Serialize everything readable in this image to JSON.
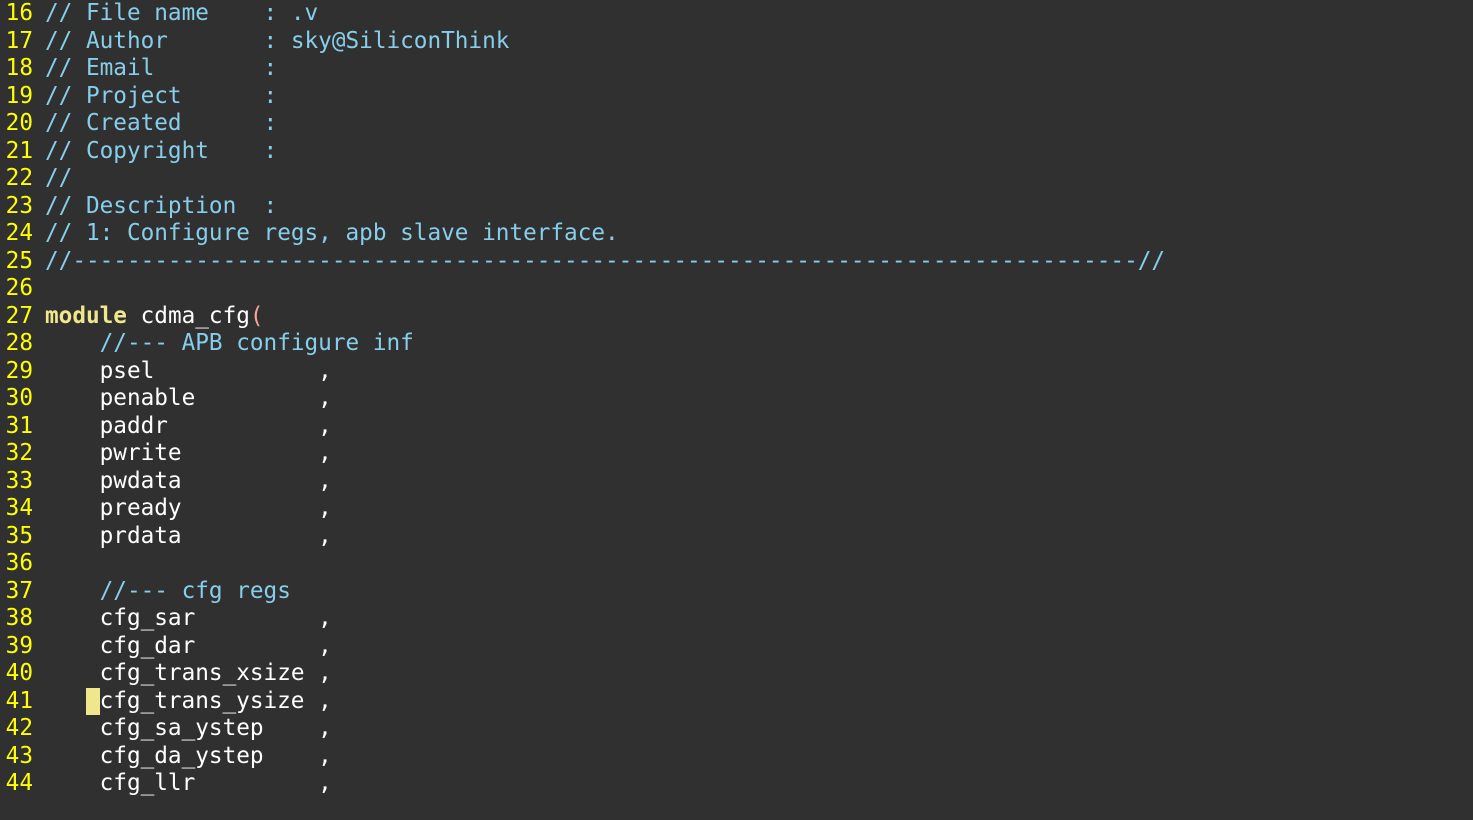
{
  "editor": {
    "lines": [
      {
        "num": "16",
        "text": "// File name    : .v"
      },
      {
        "num": "17",
        "text": "// Author       : sky@SiliconThink"
      },
      {
        "num": "18",
        "text": "// Email        :"
      },
      {
        "num": "19",
        "text": "// Project      :"
      },
      {
        "num": "20",
        "text": "// Created      :"
      },
      {
        "num": "21",
        "text": "// Copyright    :"
      },
      {
        "num": "22",
        "text": "//"
      },
      {
        "num": "23",
        "text": "// Description  :"
      },
      {
        "num": "24",
        "text": "// 1: Configure regs, apb slave interface."
      },
      {
        "num": "25",
        "text": "//------------------------------------------------------------------------------//"
      },
      {
        "num": "26",
        "text": ""
      },
      {
        "num": "27",
        "keyword": "module",
        "ident": " cdma_cfg",
        "paren": "("
      },
      {
        "num": "28",
        "text": "    //--- APB configure inf"
      },
      {
        "num": "29",
        "code": "    psel            ,"
      },
      {
        "num": "30",
        "code": "    penable         ,"
      },
      {
        "num": "31",
        "code": "    paddr           ,"
      },
      {
        "num": "32",
        "code": "    pwrite          ,"
      },
      {
        "num": "33",
        "code": "    pwdata          ,"
      },
      {
        "num": "34",
        "code": "    pready          ,"
      },
      {
        "num": "35",
        "code": "    prdata          ,"
      },
      {
        "num": "36",
        "code": ""
      },
      {
        "num": "37",
        "text": "    //--- cfg regs"
      },
      {
        "num": "38",
        "code": "    cfg_sar         ,"
      },
      {
        "num": "39",
        "code": "    cfg_dar         ,"
      },
      {
        "num": "40",
        "code": "    cfg_trans_xsize ,"
      },
      {
        "num": "41",
        "pre": "   ",
        "cursor": " ",
        "code": "cfg_trans_ysize ,"
      },
      {
        "num": "42",
        "code": "    cfg_sa_ystep    ,"
      },
      {
        "num": "43",
        "code": "    cfg_da_ystep    ,"
      },
      {
        "num": "44",
        "code": "    cfg_llr         ,"
      }
    ]
  },
  "colors": {
    "background": "#303030",
    "line_number": "#ffff00",
    "comment": "#87ceeb",
    "keyword": "#f0e68c",
    "paren": "#ffa0a0",
    "text": "#ffffff",
    "cursor": "#f0e68c"
  }
}
